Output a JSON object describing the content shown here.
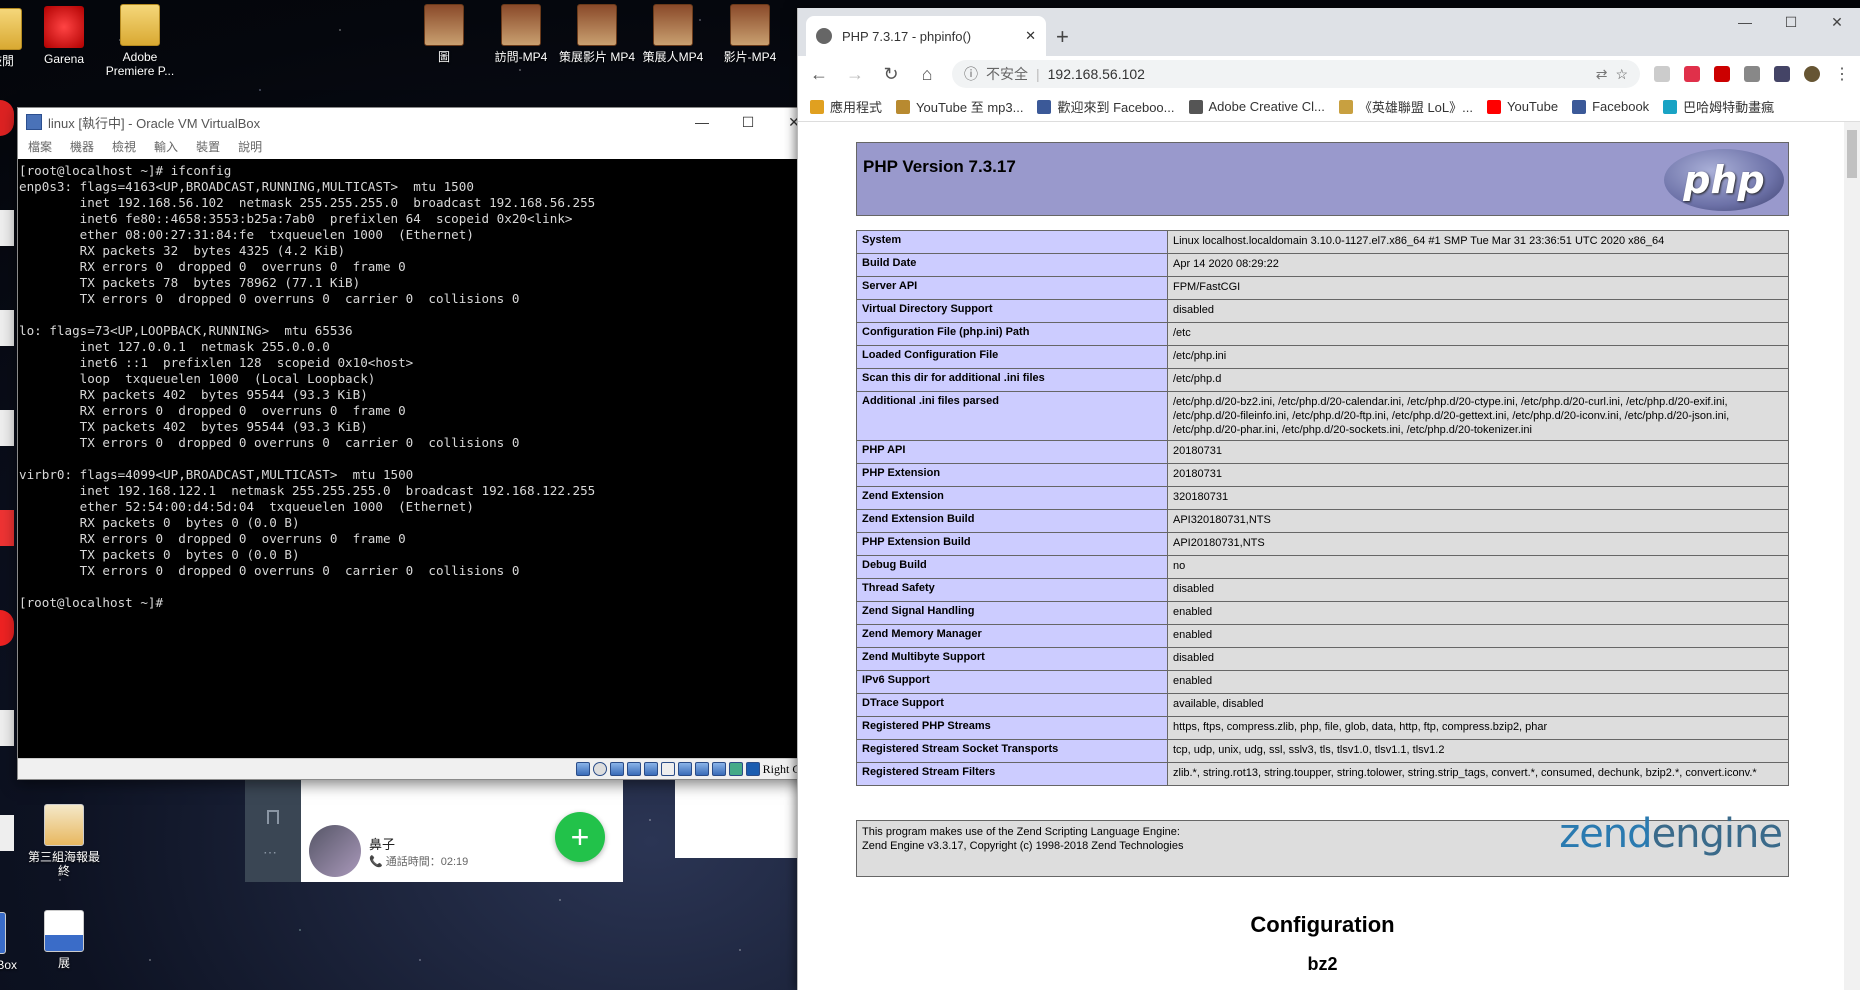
{
  "desktop": {
    "icons": [
      {
        "label": "鼓閒"
      },
      {
        "label": "Garena"
      },
      {
        "label": "Adobe Premiere P..."
      },
      {
        "label": "圖"
      },
      {
        "label": "訪問-MP4"
      },
      {
        "label": "策展影片 MP4"
      },
      {
        "label": "策展人MP4"
      },
      {
        "label": "影片-MP4"
      },
      {
        "label": "第三組海報最終"
      },
      {
        "label": "展"
      },
      {
        "label": "VM Box"
      }
    ]
  },
  "vbox": {
    "title": "linux [執行中] - Oracle VM VirtualBox",
    "menu": [
      "檔案",
      "機器",
      "檢視",
      "輸入",
      "裝置",
      "說明"
    ],
    "host_key": "Right Ctrl",
    "terminal_lines": [
      "[root@localhost ~]# ifconfig",
      "enp0s3: flags=4163<UP,BROADCAST,RUNNING,MULTICAST>  mtu 1500",
      "        inet 192.168.56.102  netmask 255.255.255.0  broadcast 192.168.56.255",
      "        inet6 fe80::4658:3553:b25a:7ab0  prefixlen 64  scopeid 0x20<link>",
      "        ether 08:00:27:31:84:fe  txqueuelen 1000  (Ethernet)",
      "        RX packets 32  bytes 4325 (4.2 KiB)",
      "        RX errors 0  dropped 0  overruns 0  frame 0",
      "        TX packets 78  bytes 78962 (77.1 KiB)",
      "        TX errors 0  dropped 0 overruns 0  carrier 0  collisions 0",
      "",
      "lo: flags=73<UP,LOOPBACK,RUNNING>  mtu 65536",
      "        inet 127.0.0.1  netmask 255.0.0.0",
      "        inet6 ::1  prefixlen 128  scopeid 0x10<host>",
      "        loop  txqueuelen 1000  (Local Loopback)",
      "        RX packets 402  bytes 95544 (93.3 KiB)",
      "        RX errors 0  dropped 0  overruns 0  frame 0",
      "        TX packets 402  bytes 95544 (93.3 KiB)",
      "        TX errors 0  dropped 0 overruns 0  carrier 0  collisions 0",
      "",
      "virbr0: flags=4099<UP,BROADCAST,MULTICAST>  mtu 1500",
      "        inet 192.168.122.1  netmask 255.255.255.0  broadcast 192.168.122.255",
      "        ether 52:54:00:d4:5d:04  txqueuelen 1000  (Ethernet)",
      "        RX packets 0  bytes 0 (0.0 B)",
      "        RX errors 0  dropped 0  overruns 0  frame 0",
      "        TX packets 0  bytes 0 (0.0 B)",
      "        TX errors 0  dropped 0 overruns 0  carrier 0  collisions 0",
      "",
      "[root@localhost ~]#"
    ]
  },
  "chat": {
    "name": "鼻子",
    "call_info": "通話時間：02:19"
  },
  "chrome": {
    "tab_title": "PHP 7.3.17 - phpinfo()",
    "insecure_label": "不安全",
    "url": "192.168.56.102",
    "bookmarks": [
      {
        "label": "應用程式",
        "color": "#e0a020"
      },
      {
        "label": "YouTube 至 mp3...",
        "color": "#b88a30"
      },
      {
        "label": "歡迎來到 Faceboo...",
        "color": "#3b5998"
      },
      {
        "label": "Adobe Creative Cl...",
        "color": "#555555"
      },
      {
        "label": "《英雄聯盟 LoL》...",
        "color": "#c8a040"
      },
      {
        "label": "YouTube",
        "color": "#ff0000"
      },
      {
        "label": "Facebook",
        "color": "#3b5998"
      },
      {
        "label": "巴哈姆特動畫瘋",
        "color": "#19a3c4"
      }
    ]
  },
  "php": {
    "version_title": "PHP Version 7.3.17",
    "logo_text": "php",
    "rows": [
      {
        "k": "System",
        "v": "Linux localhost.localdomain 3.10.0-1127.el7.x86_64 #1 SMP Tue Mar 31 23:36:51 UTC 2020 x86_64"
      },
      {
        "k": "Build Date",
        "v": "Apr 14 2020 08:29:22"
      },
      {
        "k": "Server API",
        "v": "FPM/FastCGI"
      },
      {
        "k": "Virtual Directory Support",
        "v": "disabled"
      },
      {
        "k": "Configuration File (php.ini) Path",
        "v": "/etc"
      },
      {
        "k": "Loaded Configuration File",
        "v": "/etc/php.ini"
      },
      {
        "k": "Scan this dir for additional .ini files",
        "v": "/etc/php.d"
      },
      {
        "k": "Additional .ini files parsed",
        "v": "/etc/php.d/20-bz2.ini, /etc/php.d/20-calendar.ini, /etc/php.d/20-ctype.ini, /etc/php.d/20-curl.ini, /etc/php.d/20-exif.ini, /etc/php.d/20-fileinfo.ini, /etc/php.d/20-ftp.ini, /etc/php.d/20-gettext.ini, /etc/php.d/20-iconv.ini, /etc/php.d/20-json.ini, /etc/php.d/20-phar.ini, /etc/php.d/20-sockets.ini, /etc/php.d/20-tokenizer.ini"
      },
      {
        "k": "PHP API",
        "v": "20180731"
      },
      {
        "k": "PHP Extension",
        "v": "20180731"
      },
      {
        "k": "Zend Extension",
        "v": "320180731"
      },
      {
        "k": "Zend Extension Build",
        "v": "API320180731,NTS"
      },
      {
        "k": "PHP Extension Build",
        "v": "API20180731,NTS"
      },
      {
        "k": "Debug Build",
        "v": "no"
      },
      {
        "k": "Thread Safety",
        "v": "disabled"
      },
      {
        "k": "Zend Signal Handling",
        "v": "enabled"
      },
      {
        "k": "Zend Memory Manager",
        "v": "enabled"
      },
      {
        "k": "Zend Multibyte Support",
        "v": "disabled"
      },
      {
        "k": "IPv6 Support",
        "v": "enabled"
      },
      {
        "k": "DTrace Support",
        "v": "available, disabled"
      },
      {
        "k": "Registered PHP Streams",
        "v": "https, ftps, compress.zlib, php, file, glob, data, http, ftp, compress.bzip2, phar"
      },
      {
        "k": "Registered Stream Socket Transports",
        "v": "tcp, udp, unix, udg, ssl, sslv3, tls, tlsv1.0, tlsv1.1, tlsv1.2"
      },
      {
        "k": "Registered Stream Filters",
        "v": "zlib.*, string.rot13, string.toupper, string.tolower, string.strip_tags, convert.*, consumed, dechunk, bzip2.*, convert.iconv.*"
      }
    ],
    "zend_line1": "This program makes use of the Zend Scripting Language Engine:",
    "zend_line2": "Zend Engine v3.3.17, Copyright (c) 1998-2018 Zend Technologies",
    "zend_logo_a": "zend",
    "zend_logo_b": "engine",
    "config_heading": "Configuration",
    "section_heading": "bz2"
  }
}
